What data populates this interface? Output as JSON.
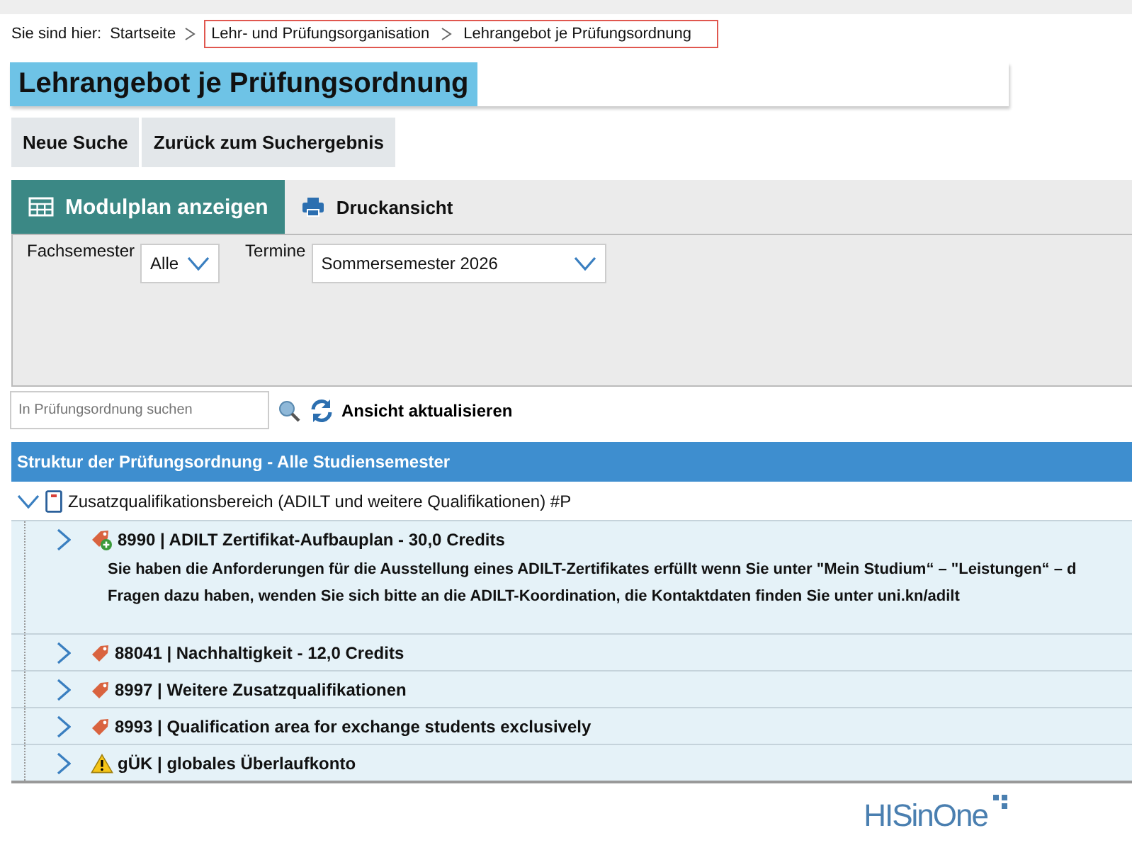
{
  "breadcrumb": {
    "label": "Sie sind hier:",
    "items": [
      "Startseite"
    ],
    "highlighted_items": [
      "Lehr- und Prüfungsorganisation",
      "Lehrangebot je Prüfungsordnung"
    ]
  },
  "page_title": "Lehrangebot je Prüfungsordnung",
  "buttons": [
    "Neue Suche",
    "Zurück zum Suchergebnis"
  ],
  "tabs": [
    {
      "label": "Modulplan anzeigen",
      "kind": "grid",
      "selected": true
    },
    {
      "label": "Druckansicht",
      "kind": "printer",
      "selected": false
    }
  ],
  "filters": [
    {
      "label": "Fachsemester",
      "value": "Alle"
    },
    {
      "label": "Termine",
      "value": "Sommersemester 2026"
    }
  ],
  "search": {
    "placeholder": "In Prüfungsordnung suchen"
  },
  "refresh_button": "Ansicht aktualisieren",
  "tree": {
    "header": "Struktur der Prüfungsordnung - Alle Studiensemester",
    "root": {
      "label": "Zusatzqualifikationsbereich (ADILT und weitere Qualifikationen) #P",
      "kind": "module",
      "expanded": true,
      "children": [
        {
          "label": "8990 | ADILT Zertifikat-Aufbauplan - 30,0 Credits",
          "kind": "tag-plus",
          "expanded": false,
          "note": [
            "Sie haben die Anforderungen für die Ausstellung eines ADILT-Zertifikates erfüllt wenn Sie unter \"Mein Studium“ – \"Leistungen“ – d",
            "Fragen dazu haben, wenden Sie sich bitte an die ADILT-Koordination, die Kontaktdaten finden Sie unter uni.kn/adilt"
          ]
        },
        {
          "label": "88041 | Nachhaltigkeit - 12,0 Credits",
          "kind": "tag",
          "expanded": false
        },
        {
          "label": "8997 | Weitere Zusatzqualifikationen",
          "kind": "tag",
          "expanded": false
        },
        {
          "label": "8993 | Qualification area for exchange students exclusively",
          "kind": "tag",
          "expanded": false
        },
        {
          "label": "gÜK | globales Überlaufkonto",
          "kind": "warning",
          "expanded": false
        }
      ]
    }
  },
  "footer": {
    "logo": "HISinOne"
  }
}
